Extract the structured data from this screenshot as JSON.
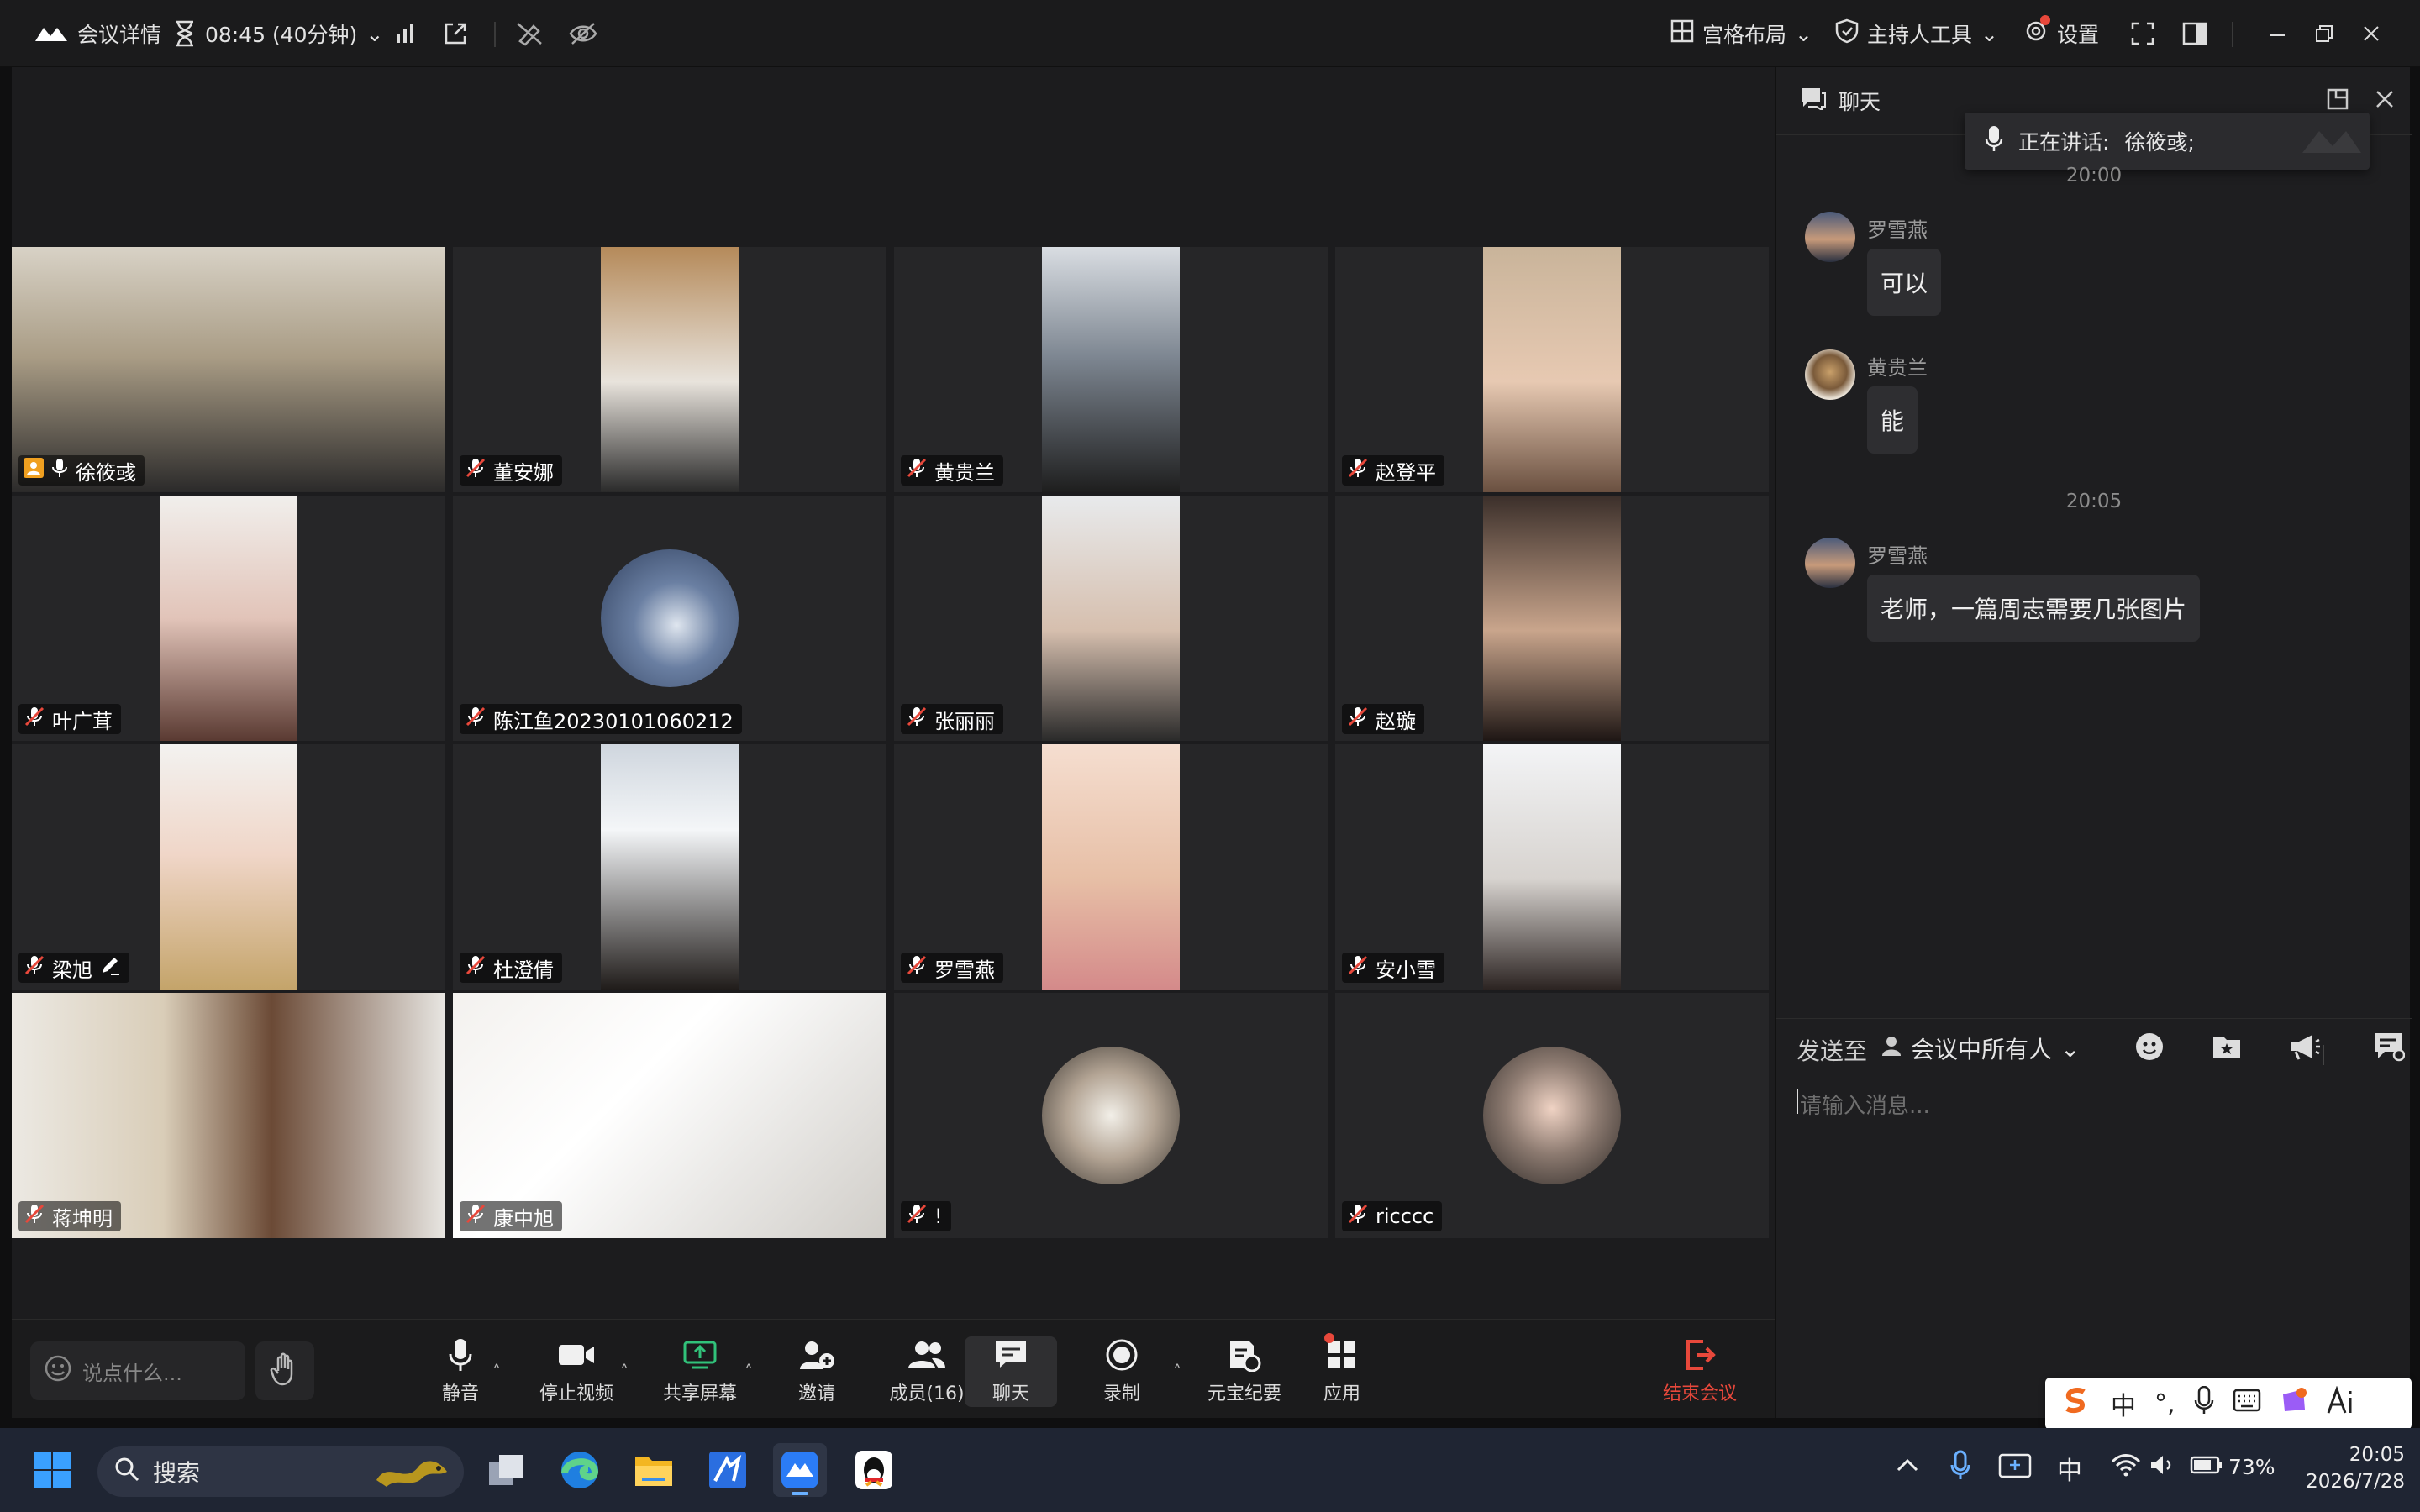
{
  "topbar": {
    "meeting_details": "会议详情",
    "timer": "08:45 (40分钟)",
    "layout": "宫格布局",
    "host_tools": "主持人工具",
    "settings": "设置"
  },
  "tiles": [
    {
      "name": "徐筱彧",
      "type": "camera",
      "muted": false,
      "active": true,
      "host": true
    },
    {
      "name": "董安娜",
      "type": "camera",
      "muted": true
    },
    {
      "name": "黄贵兰",
      "type": "camera",
      "muted": true
    },
    {
      "name": "赵登平",
      "type": "camera",
      "muted": true
    },
    {
      "name": "叶广茸",
      "type": "camera",
      "muted": true
    },
    {
      "name": "陈江鱼20230101060212",
      "type": "avatar",
      "muted": true
    },
    {
      "name": "张丽丽",
      "type": "camera",
      "muted": true
    },
    {
      "name": "赵璇",
      "type": "camera",
      "muted": true
    },
    {
      "name": "梁旭",
      "type": "camera",
      "muted": true,
      "annotating": true
    },
    {
      "name": "杜澄倩",
      "type": "camera",
      "muted": true
    },
    {
      "name": "罗雪燕",
      "type": "camera",
      "muted": true
    },
    {
      "name": "安小雪",
      "type": "camera",
      "muted": true
    },
    {
      "name": "蒋坤明",
      "type": "camera-full",
      "muted": true
    },
    {
      "name": "康中旭",
      "type": "camera-full",
      "muted": true
    },
    {
      "name": "!",
      "type": "avatar",
      "muted": true
    },
    {
      "name": "ricccc",
      "type": "avatar",
      "muted": true
    }
  ],
  "toolbar": {
    "say_something": "说点什么...",
    "mute": "静音",
    "stop_video": "停止视频",
    "share_screen": "共享屏幕",
    "invite": "邀请",
    "members": "成员(16)",
    "chat": "聊天",
    "record": "录制",
    "yuanbao": "元宝纪要",
    "apps": "应用",
    "end_meeting": "结束会议"
  },
  "chat": {
    "title": "聊天",
    "speaking_label": "正在讲话:",
    "speaking_name": "徐筱彧;",
    "messages": [
      {
        "time": "20:00",
        "sender": "罗雪燕",
        "text": "可以"
      },
      {
        "sender": "黄贵兰",
        "text": "能"
      },
      {
        "time": "20:05",
        "sender": "罗雪燕",
        "text": "老师，一篇周志需要几张图片"
      }
    ],
    "send_to_label": "发送至",
    "send_to_target": "会议中所有人",
    "input_placeholder": "请输入消息..."
  },
  "ime": {
    "lang": "中",
    "punct": "°,"
  },
  "taskbar": {
    "search": "搜索",
    "lang": "中",
    "battery": "73%",
    "time": "20:05",
    "date": "2026/7/28"
  },
  "colors": {
    "accent_green": "#31c27a",
    "danger": "#e8483b",
    "brand_blue": "#3a7ef6"
  }
}
